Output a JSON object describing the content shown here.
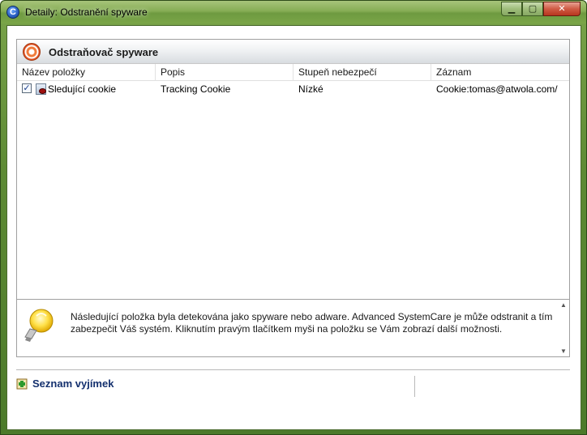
{
  "window": {
    "title": "Detaily: Odstranění spyware",
    "app_icon": "C",
    "minimize_label": "▁",
    "maximize_label": "▢",
    "close_label": "✕"
  },
  "panel": {
    "title": "Odstraňovač spyware",
    "columns": [
      "Název položky",
      "Popis",
      "Stupeň nebezpečí",
      "Záznam"
    ],
    "rows": [
      {
        "checked": true,
        "checkbox_mark": "✓",
        "name": "Sledující cookie",
        "description": "Tracking Cookie",
        "danger": "Nízké",
        "record": "Cookie:tomas@atwola.com/"
      }
    ]
  },
  "info": {
    "text": "Následující položka byla detekována jako spyware nebo adware. Advanced SystemCare je může odstranit a tím zabezpečit Váš systém. Kliknutím pravým tlačítkem myši na položku se Vám zobrazí další možnosti.",
    "scroll_up": "▲",
    "scroll_down": "▼"
  },
  "footer": {
    "exceptions_label": "Seznam vyjímek"
  }
}
